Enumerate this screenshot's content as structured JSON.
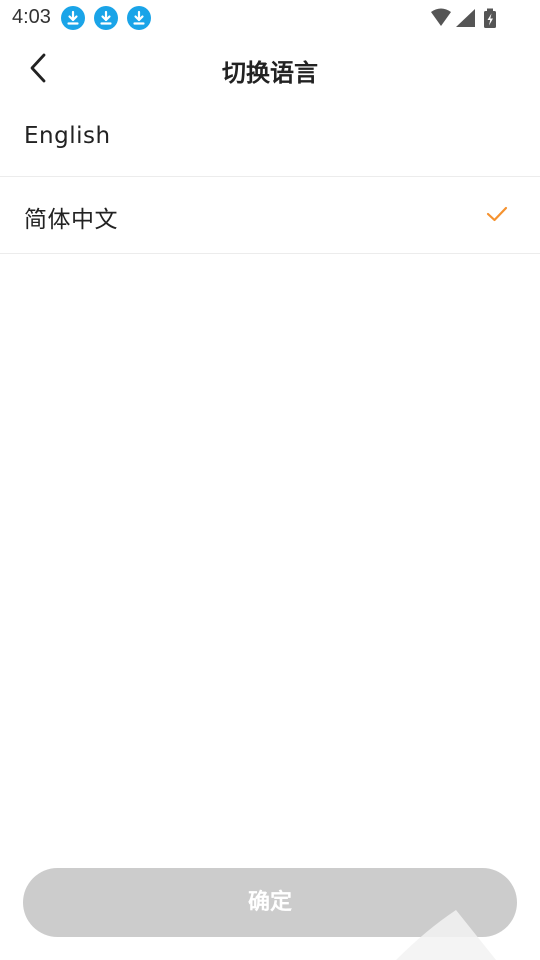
{
  "status_bar": {
    "time": "4:03",
    "notification_icons": [
      "download-icon",
      "download-icon",
      "download-icon"
    ],
    "notification_color": "#1aa4e8",
    "system_icons": [
      "wifi-icon",
      "cellular-signal-icon",
      "battery-charging-icon"
    ]
  },
  "header": {
    "title": "切换语言",
    "back_icon": "chevron-left-icon"
  },
  "languages": [
    {
      "label": "English",
      "selected": false
    },
    {
      "label": "简体中文",
      "selected": true
    }
  ],
  "check_color": "#f5922f",
  "confirm_button": {
    "label": "确定",
    "background": "#cccccc",
    "state": "disabled"
  }
}
